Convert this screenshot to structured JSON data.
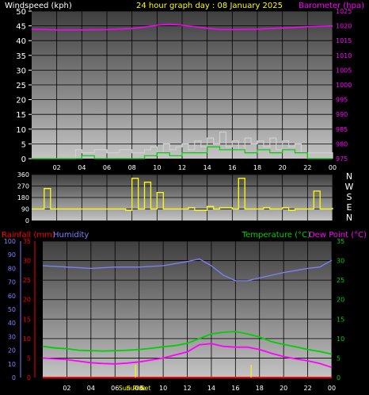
{
  "header": {
    "windspeed_label": "Windspeed (kph)",
    "center_label": "24 hour graph day : 08 January 2025",
    "barometer_label": "Barometer (hpa)"
  },
  "bottom_header": {
    "rainfall_label": "Rainfall (mm)",
    "humidity_label": "Humidity",
    "temperature_label": "Temperature (°C)",
    "dewpoint_label": "Dew Point (°C)"
  },
  "compass_letters": [
    "N",
    "W",
    "S",
    "E",
    "N"
  ],
  "sun_labels": {
    "sunrise": "Sun Rise",
    "sunset": "Sun Set"
  },
  "colors": {
    "wind": "#ffffff",
    "gust": "#d0d0d0",
    "wind_avg": "#00d000",
    "barometer": "#ff00ff",
    "direction": "#ffff00",
    "rainfall": "#ff0000",
    "humidity": "#8080ff",
    "temperature": "#00d000",
    "dewpoint": "#ff00ff"
  },
  "chart_data": [
    {
      "type": "line",
      "name": "wind-barometer",
      "x_ticks": [
        "02",
        "04",
        "06",
        "08",
        "10",
        "12",
        "14",
        "16",
        "18",
        "20",
        "22",
        "00"
      ],
      "y_left_ticks": [
        "0",
        "5",
        "10",
        "15",
        "20",
        "25",
        "30",
        "35",
        "40",
        "45",
        "50"
      ],
      "y_left_range": [
        0,
        50
      ],
      "y_right_ticks": [
        "975",
        "980",
        "985",
        "990",
        "995",
        "1000",
        "1005",
        "1010",
        "1015",
        "1020",
        "1025"
      ],
      "y_right_range": [
        975,
        1025
      ],
      "series": [
        {
          "key": "barometer",
          "hours": [
            0,
            2,
            4,
            6,
            8,
            9,
            10,
            11,
            12,
            13,
            14,
            15,
            16,
            18,
            20,
            22,
            24
          ],
          "values": [
            1018.9,
            1018.6,
            1018.6,
            1018.7,
            1019.1,
            1019.6,
            1020.2,
            1020.6,
            1020.2,
            1019.7,
            1019.2,
            1018.8,
            1018.7,
            1018.9,
            1019.3,
            1019.7,
            1020.0
          ]
        },
        {
          "key": "wind_avg",
          "hours": [
            0,
            3,
            4,
            5,
            6,
            8,
            9,
            10,
            11,
            12,
            13,
            14,
            15,
            16,
            17,
            18,
            19,
            20,
            21,
            22,
            23,
            24
          ],
          "values": [
            0,
            0,
            1,
            0,
            0,
            0,
            1,
            2,
            1,
            2,
            2,
            4,
            3,
            3,
            2,
            3,
            2,
            3,
            2,
            0,
            0,
            0
          ]
        },
        {
          "key": "gust",
          "hours": [
            0,
            3,
            3.5,
            4,
            5,
            6,
            7,
            8,
            9,
            9.5,
            10,
            10.5,
            11,
            11.5,
            12,
            12.5,
            13,
            13.5,
            14,
            14.5,
            15,
            15.5,
            16,
            16.5,
            17,
            17.5,
            18,
            18.5,
            19,
            19.5,
            20,
            20.5,
            21,
            21.5,
            22,
            23,
            24
          ],
          "values": [
            0,
            0,
            3,
            2,
            3,
            2,
            3,
            2,
            3,
            4,
            2,
            5,
            3,
            4,
            5,
            3,
            6,
            4,
            7,
            5,
            9,
            4,
            6,
            3,
            7,
            5,
            6,
            4,
            7,
            3,
            6,
            4,
            5,
            2,
            2,
            2,
            0
          ]
        }
      ]
    },
    {
      "type": "line",
      "name": "wind-direction",
      "x_ticks": [
        "02",
        "04",
        "06",
        "08",
        "10",
        "12",
        "14",
        "16",
        "18",
        "20",
        "22",
        "00"
      ],
      "y_ticks": [
        "0",
        "90",
        "180",
        "270",
        "360"
      ],
      "y_ticks_shown": [
        "360",
        "270",
        "180",
        "90",
        "0"
      ],
      "y_range": [
        0,
        360
      ],
      "series": [
        {
          "key": "direction",
          "hours": [
            0,
            1,
            1.5,
            2,
            3,
            4,
            5,
            6,
            7,
            7.5,
            8,
            8.5,
            9,
            9.5,
            10,
            10.5,
            11,
            12,
            12.5,
            13,
            14,
            14.5,
            15,
            16,
            16.5,
            17,
            18,
            18.5,
            19,
            20,
            20.5,
            21,
            22,
            22.5,
            23,
            24
          ],
          "values": [
            90,
            250,
            90,
            90,
            90,
            90,
            90,
            90,
            90,
            80,
            330,
            90,
            300,
            90,
            220,
            90,
            90,
            90,
            100,
            80,
            110,
            90,
            100,
            90,
            330,
            90,
            90,
            100,
            90,
            100,
            80,
            90,
            90,
            230,
            90,
            100
          ]
        }
      ]
    },
    {
      "type": "line",
      "name": "rain-humidity-temperature",
      "x_ticks": [
        "02",
        "04",
        "06",
        "08",
        "10",
        "12",
        "14",
        "16",
        "18",
        "20",
        "22",
        "00"
      ],
      "y_rain_ticks": [
        "0",
        "5",
        "10",
        "15",
        "20",
        "25",
        "30",
        "35"
      ],
      "y_rain_range": [
        0,
        35
      ],
      "y_humidity_ticks": [
        "0",
        "10",
        "20",
        "30",
        "40",
        "50",
        "60",
        "70",
        "80",
        "90",
        "100"
      ],
      "y_humidity_range": [
        0,
        100
      ],
      "y_temp_ticks": [
        "0",
        "5",
        "10",
        "15",
        "20",
        "25",
        "30",
        "35"
      ],
      "y_temp_range": [
        0,
        35
      ],
      "series": [
        {
          "key": "humidity",
          "hours": [
            0,
            2,
            4,
            6,
            8,
            10,
            12,
            13,
            14,
            15,
            16,
            17,
            18,
            20,
            22,
            23,
            24
          ],
          "values": [
            82,
            81,
            80,
            81,
            81,
            82,
            85,
            87,
            82,
            75,
            71,
            71,
            73,
            77,
            80,
            81,
            86
          ]
        },
        {
          "key": "temperature",
          "hours": [
            0,
            1,
            2,
            3,
            4,
            5,
            6,
            7,
            8,
            9,
            10,
            11,
            12,
            13,
            14,
            15,
            16,
            17,
            18,
            19,
            20,
            21,
            22,
            23,
            24
          ],
          "values": [
            8.0,
            7.6,
            7.4,
            7.0,
            6.9,
            6.8,
            6.9,
            7.0,
            7.2,
            7.5,
            7.9,
            8.2,
            8.8,
            10.0,
            11.2,
            11.6,
            11.8,
            11.2,
            10.4,
            9.2,
            8.5,
            7.9,
            7.2,
            6.7,
            6.0
          ]
        },
        {
          "key": "dewpoint",
          "hours": [
            0,
            1,
            2,
            3,
            4,
            5,
            6,
            7,
            8,
            9,
            10,
            11,
            12,
            13,
            14,
            15,
            16,
            17,
            18,
            19,
            20,
            21,
            22,
            23,
            24
          ],
          "values": [
            5.0,
            4.8,
            4.6,
            4.2,
            3.8,
            3.6,
            3.5,
            3.7,
            4.0,
            4.5,
            5.0,
            5.8,
            6.6,
            8.4,
            8.7,
            8.0,
            7.8,
            7.8,
            7.2,
            6.2,
            5.4,
            4.8,
            4.3,
            3.6,
            2.6
          ]
        },
        {
          "key": "rainfall",
          "hours": [
            0,
            24
          ],
          "values": [
            0,
            0
          ]
        }
      ],
      "markers": {
        "sunrise_hour": 7.7,
        "sunset_hour": 17.3
      }
    }
  ]
}
